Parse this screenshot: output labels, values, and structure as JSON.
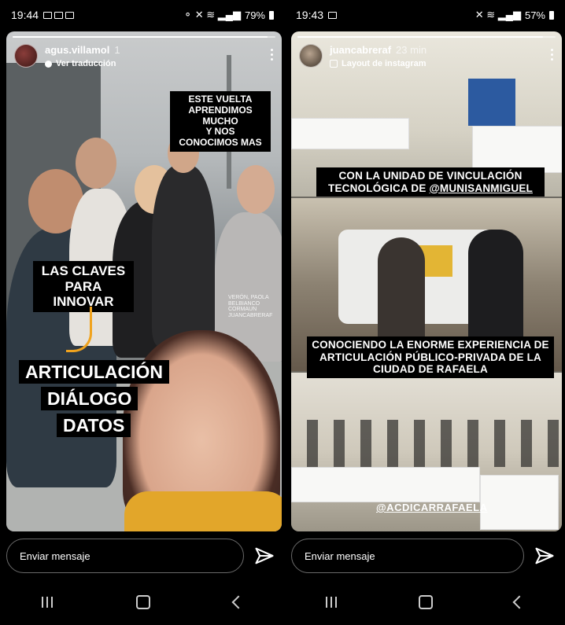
{
  "left": {
    "status": {
      "time": "19:44",
      "battery": "79%"
    },
    "story": {
      "username": "agus.villamol",
      "age": "1",
      "subline": "Ver traducción",
      "progress": 0.97,
      "tags": {
        "top_right": "ESTE VUELTA\nAPRENDIMOS MUCHO\nY NOS CONOCIMOS MAS",
        "claves": "LAS CLAVES\nPARA INNOVAR",
        "word1": "ARTICULACIÓN",
        "word2": "DIÁLOGO",
        "word3": "DATOS"
      },
      "credit": "VERÓN, PAOLA\nBELBIANCO\nCORMAUN\nJUANCABRERAF"
    },
    "reply_placeholder": "Enviar mensaje"
  },
  "right": {
    "status": {
      "time": "19:43",
      "battery": "57%"
    },
    "story": {
      "username": "juancabreraf",
      "age": "23 min",
      "subline": "Layout de instagram",
      "progress": 0.95,
      "tag1_pre": "CON LA UNIDAD DE VINCULACIÓN\nTECNOLÓGICA DE ",
      "tag1_handle": "@MUNISANMIGUEL",
      "tag2": "CONOCIENDO LA ENORME EXPERIENCIA DE\nARTICULACIÓN PÚBLICO-PRIVADA DE LA\nCIUDAD DE RAFAELA",
      "handle_link": "@ACDICARRAFAELA"
    },
    "reply_placeholder": "Enviar mensaje"
  },
  "icons": {
    "send": "paper-plane-icon",
    "more": "more-vertical-icon",
    "recent": "recent-apps-icon",
    "home": "home-icon",
    "back": "back-icon"
  },
  "colors": {
    "accent_orange": "#f0a31e",
    "tag_bg": "#000000"
  }
}
